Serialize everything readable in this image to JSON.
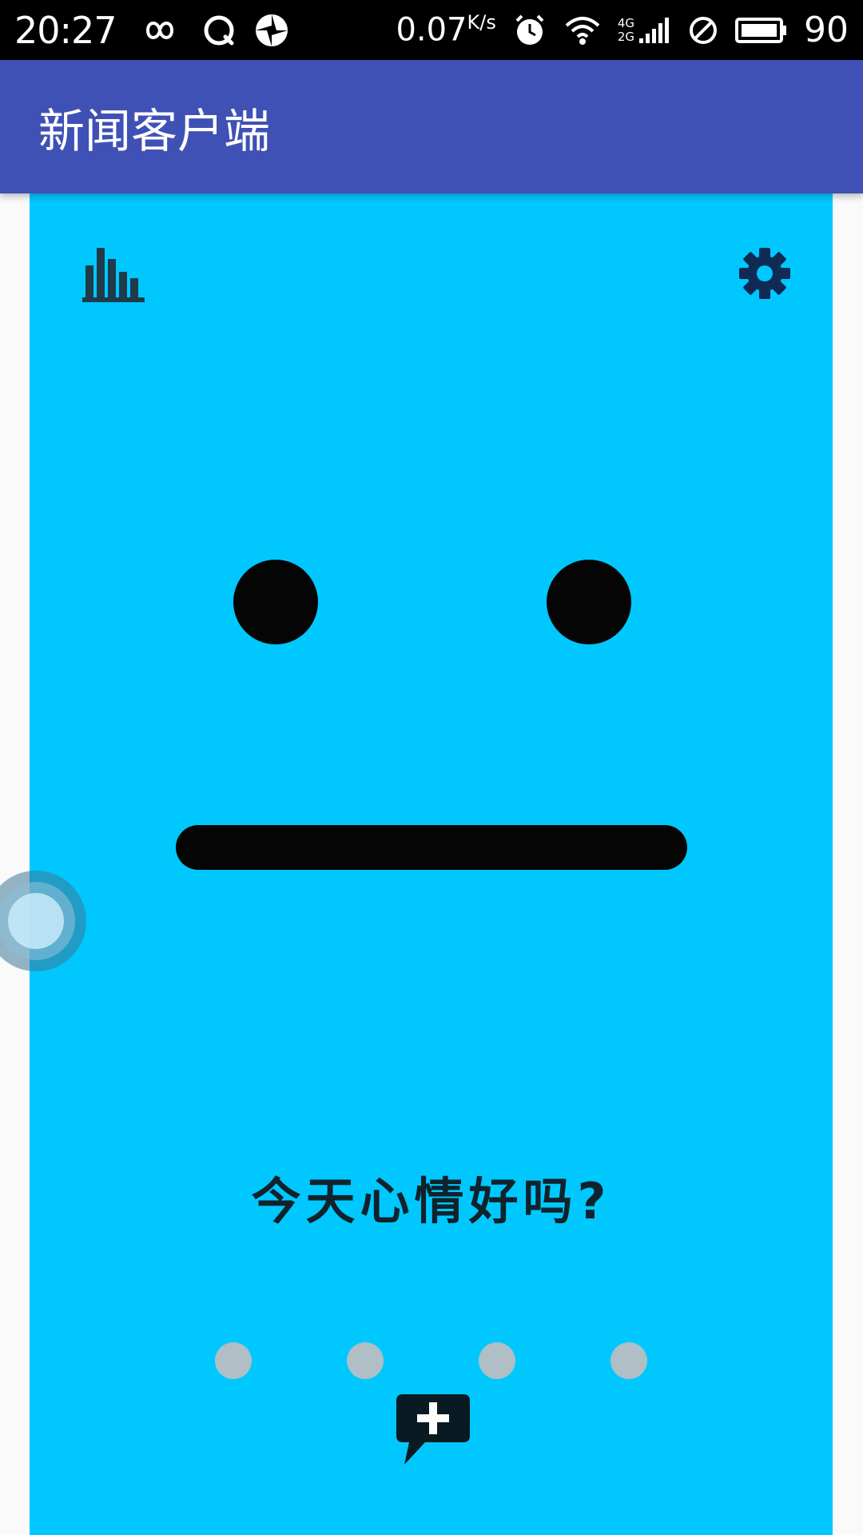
{
  "status_bar": {
    "time": "20:27",
    "network_speed": "0.07",
    "network_speed_unit": "K/s",
    "network_type_top": "4G",
    "network_type_bottom": "2G",
    "battery_level": "90",
    "icons": [
      "infinity-icon",
      "qq-icon",
      "aperture-icon",
      "alarm-icon",
      "wifi-icon",
      "signal-icon",
      "no-disturb-icon",
      "battery-icon"
    ]
  },
  "app_bar": {
    "title": "新闻客户端",
    "color": "#3f51b5"
  },
  "mood_card": {
    "background_color": "#00c8ff",
    "question": "今天心情好吗?",
    "face_expression": "neutral",
    "top_left_icon": "bar-chart-icon",
    "top_right_icon": "gear-icon",
    "bottom_icon": "add-comment-icon",
    "page_dot_count": 4,
    "page_dot_color": "#b0bec5"
  }
}
